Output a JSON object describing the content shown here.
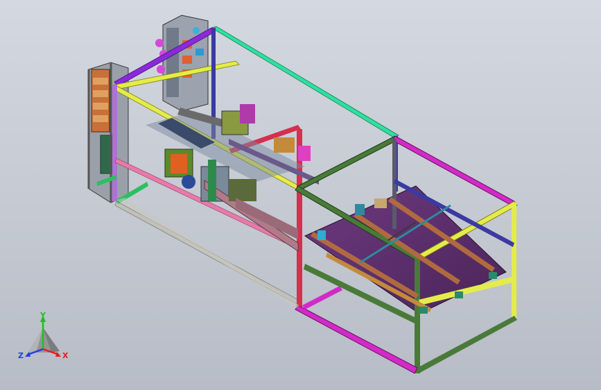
{
  "viewport": {
    "background": [
      "#d4d8e0",
      "#b7bcc6"
    ]
  },
  "triad": {
    "labels": {
      "x": "X",
      "y": "Y",
      "z": "Z"
    },
    "colors": {
      "x": "#e02020",
      "y": "#20c020",
      "z": "#2040e0"
    }
  },
  "colors": {
    "purple": "#8a2ad8",
    "yellow": "#e4ec4a",
    "cyan_green": "#2ee0a0",
    "magenta": "#d22ac8",
    "red": "#d43050",
    "pink": "#e87aa8",
    "olive": "#4a7a3a",
    "navy": "#3a3aa0",
    "green": "#2ac060",
    "tan": "#b89a6a",
    "deck": "#5a2f6a",
    "gray_frame": "#8a8a8a"
  }
}
